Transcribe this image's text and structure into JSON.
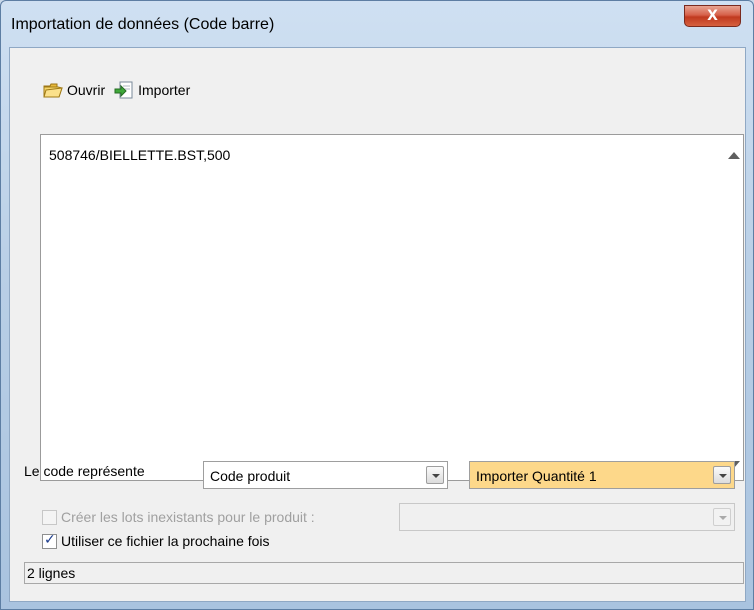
{
  "window": {
    "title": "Importation de données (Code barre)",
    "close_label": "X"
  },
  "toolbar": {
    "open_label": "Ouvrir",
    "open_icon": "folder-open-icon",
    "import_label": "Importer",
    "import_icon": "import-arrow-icon"
  },
  "editor": {
    "content": "508746/BIELLETTE.BST,500"
  },
  "code_row": {
    "label": "Le code représente",
    "code_type": {
      "value": "Code produit"
    },
    "quantity_mode": {
      "value": "Importer Quantité 1",
      "highlight_color": "#fdd88a"
    }
  },
  "options": {
    "create_lots": {
      "label": "Créer les lots inexistants pour le produit :",
      "checked": false,
      "enabled": false
    },
    "lot_product_select": {
      "value": ""
    },
    "reuse_file": {
      "label": "Utiliser ce fichier la prochaine fois",
      "checked": true
    }
  },
  "status": {
    "text": "2 lignes"
  }
}
